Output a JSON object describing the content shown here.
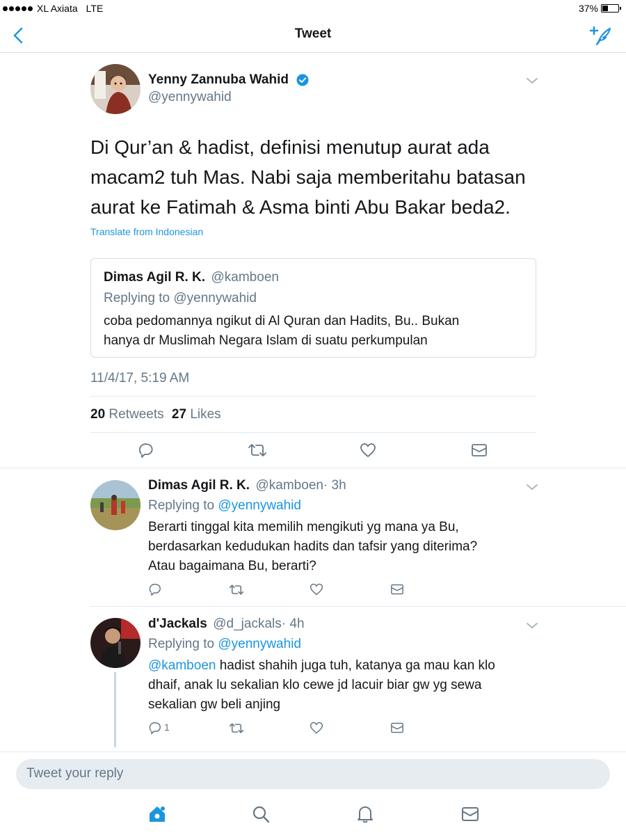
{
  "status_bar": {
    "carrier": "XL Axiata",
    "network": "LTE",
    "battery_percent": "37%"
  },
  "nav": {
    "title": "Tweet",
    "back_icon": "back-chevron-icon",
    "compose_icon": "compose-tweet-icon"
  },
  "tweet": {
    "author_name": "Yenny Zannuba Wahid",
    "author_handle": "@yennywahid",
    "verified_icon": "verified-badge-icon",
    "text_line1": "Di Qur’an & hadist, definisi menutup aurat ada",
    "text_line2": "macam2 tuh Mas. Nabi saja memberitahu batasan",
    "text_line3": "aurat ke Fatimah & Asma binti Abu Bakar beda2.",
    "translate": "Translate from Indonesian",
    "quoted": {
      "author_name": "Dimas Agil R. K.",
      "author_handle": "@kamboen",
      "replying_to": "Replying to @yennywahid",
      "text_line1": "coba pedomannya ngikut di Al Quran dan Hadits, Bu.. Bukan",
      "text_line2": "hanya dr Muslimah Negara Islam di suatu perkumpulan"
    },
    "timestamp": "11/4/17, 5:19 AM",
    "retweets_count": "20",
    "retweets_label": "Retweets",
    "likes_count": "27",
    "likes_label": "Likes"
  },
  "replies": [
    {
      "author_name": "Dimas Agil R. K.",
      "author_handle": "@kamboen",
      "time": "· 3h",
      "replying_label": "Replying to",
      "replying_handle": "@yennywahid",
      "text_line1": "Berarti tinggal kita memilih mengikuti yg mana ya Bu,",
      "text_line2": "berdasarkan kedudukan hadits dan tafsir yang diterima?",
      "text_line3": "Atau bagaimana Bu, berarti?",
      "reply_count": ""
    },
    {
      "author_name": "d'Jackals",
      "author_handle": "@d_jackals",
      "time": "· 4h",
      "replying_label": "Replying to",
      "replying_handle": "@yennywahid",
      "mention": "@kamboen",
      "text_line1": " hadist shahih juga tuh, katanya ga mau kan klo",
      "text_line2": "dhaif, anak lu sekalian klo cewe jd lacuir biar gw yg sewa",
      "text_line3": "sekalian gw beli anjing",
      "reply_count": "1"
    }
  ],
  "composer": {
    "placeholder": "Tweet your reply"
  },
  "tabbar": {
    "home_icon": "home-icon",
    "search_icon": "search-icon",
    "notifications_icon": "bell-icon",
    "messages_icon": "mail-icon"
  },
  "colors": {
    "accent": "#1b95e0",
    "secondary_text": "#657786",
    "divider": "#e1e8ed"
  }
}
